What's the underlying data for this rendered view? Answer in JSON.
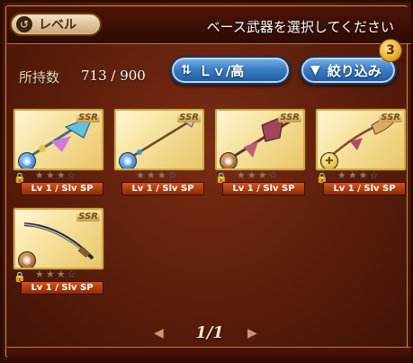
{
  "header": {
    "level_button_label": "レベル",
    "level_button_icon": "↺",
    "title": "ベース武器を選択してください"
  },
  "inventory": {
    "count_label": "所持数",
    "count_value": "713 / 900"
  },
  "sort_button": {
    "icon": "⇅",
    "label": "Ｌｖ/高"
  },
  "filter_button": {
    "icon": "▼",
    "label": "絞り込み",
    "badge": "3"
  },
  "weapons": [
    {
      "rarity": "SSR",
      "element": "water",
      "element_glyph": "◉",
      "stars": 3,
      "max_stars": 4,
      "level_text": "Lv 1 / Slv SP",
      "locked": true
    },
    {
      "rarity": "SSR",
      "element": "water",
      "element_glyph": "◉",
      "stars": 3,
      "max_stars": 4,
      "level_text": "Lv 1 / Slv SP",
      "locked": false
    },
    {
      "rarity": "SSR",
      "element": "earth",
      "element_glyph": "◉",
      "stars": 3,
      "max_stars": 4,
      "level_text": "Lv 1 / Slv SP",
      "locked": true
    },
    {
      "rarity": "SSR",
      "element": "light",
      "element_glyph": "✚",
      "stars": 3,
      "max_stars": 4,
      "level_text": "Lv 1 / Slv SP",
      "locked": true
    },
    {
      "rarity": "SSR",
      "element": "earth",
      "element_glyph": "◉",
      "stars": 3,
      "max_stars": 4,
      "level_text": "Lv 1 / Slv SP",
      "locked": true
    }
  ],
  "pager": {
    "page_text": "1/1",
    "prev_glyph": "◀",
    "next_glyph": "▶"
  }
}
